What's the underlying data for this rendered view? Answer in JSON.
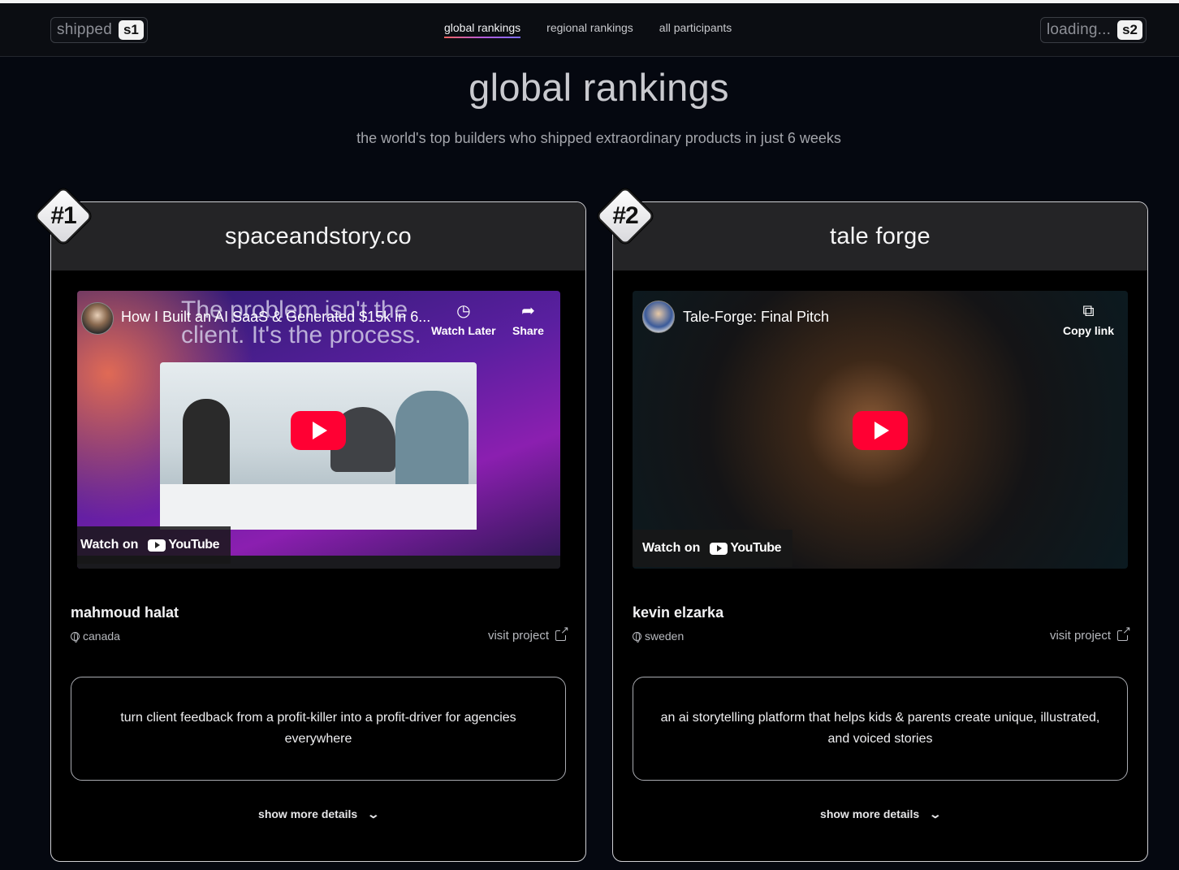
{
  "header": {
    "left_pill": {
      "text": "shipped",
      "tag": "s1"
    },
    "right_pill": {
      "text": "loading...",
      "tag": "s2"
    },
    "nav": [
      {
        "label": "global rankings",
        "active": true
      },
      {
        "label": "regional rankings",
        "active": false
      },
      {
        "label": "all participants",
        "active": false
      }
    ]
  },
  "page": {
    "title": "global rankings",
    "subtitle": "the world's top builders who shipped extraordinary products in just 6 weeks"
  },
  "cards": [
    {
      "rank": "#1",
      "title": "spaceandstory.co",
      "video": {
        "title": "How I Built an AI SaaS & Generated $15k in 6...",
        "overlay_text": "The problem isn't the client. It's the process.",
        "action1_label": "Watch Later",
        "action1_icon": "clock-icon",
        "action2_label": "Share",
        "action2_icon": "share-icon",
        "watch_on": "Watch on",
        "brand": "YouTube"
      },
      "author": "mahmoud halat",
      "country": "canada",
      "visit": "visit project",
      "description": "turn client feedback from a profit-killer into a profit-driver for agencies everywhere",
      "more": "show more details"
    },
    {
      "rank": "#2",
      "title": "tale forge",
      "video": {
        "title": "Tale-Forge: Final Pitch",
        "action1_label": "Copy link",
        "action1_icon": "copy-icon",
        "watch_on": "Watch on",
        "brand": "YouTube"
      },
      "author": "kevin elzarka",
      "country": "sweden",
      "visit": "visit project",
      "description": "an ai storytelling platform that helps kids & parents create unique, illustrated, and voiced stories",
      "more": "show more details"
    }
  ],
  "colors": {
    "background": "#050810",
    "card_header": "#242426",
    "youtube_red": "#ff0033",
    "nav_gradient": [
      "#f0635f",
      "#b65bd9",
      "#7c6ef7"
    ]
  }
}
